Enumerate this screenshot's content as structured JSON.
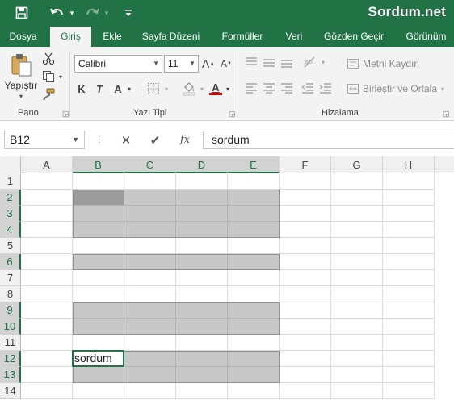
{
  "brand": "Sordum.net",
  "tabs": [
    "Dosya",
    "Giriş",
    "Ekle",
    "Sayfa Düzeni",
    "Formüller",
    "Veri",
    "Gözden Geçir",
    "Görünüm"
  ],
  "active_tab": "Giriş",
  "ribbon": {
    "clipboard": {
      "label": "Pano",
      "paste_label": "Yapıştır"
    },
    "font": {
      "label": "Yazı Tipi",
      "font_name": "Calibri",
      "font_size": "11",
      "bold": "K",
      "italic": "T",
      "underline": "A",
      "grow": "A",
      "shrink": "A",
      "color": "A"
    },
    "alignment": {
      "label": "Hizalama",
      "wrap_text": "Metni Kaydır",
      "merge_center": "Birleştir ve Ortala"
    }
  },
  "formula_bar": {
    "name_box": "B12",
    "cancel": "✕",
    "enter": "✔",
    "fx": "fx",
    "content": "sordum"
  },
  "sheet": {
    "columns": [
      "A",
      "B",
      "C",
      "D",
      "E",
      "F",
      "G",
      "H"
    ],
    "rows": [
      "1",
      "2",
      "3",
      "4",
      "5",
      "6",
      "7",
      "8",
      "9",
      "10",
      "11",
      "12",
      "13",
      "14"
    ],
    "selected_columns": [
      "B",
      "C",
      "D",
      "E"
    ],
    "selected_rows": [
      "2",
      "3",
      "4",
      "6",
      "9",
      "10",
      "12",
      "13"
    ],
    "active_cell": "B12",
    "active_cell_value": "sordum",
    "selection_shade_color": "#c8c8c8",
    "accent_color": "#217346"
  }
}
